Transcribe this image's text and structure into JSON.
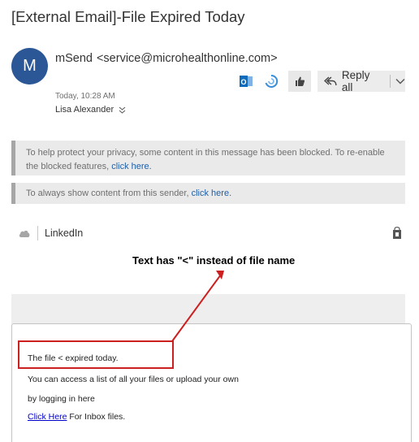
{
  "email": {
    "subject": "[External Email]-File Expired Today",
    "avatar_initial": "M",
    "sender_name": "mSend",
    "sender_address": "<service@microhealthonline.com>",
    "time": "Today, 10:28 AM",
    "recipient": "Lisa Alexander"
  },
  "toolbar": {
    "reply_all_label": "Reply all"
  },
  "notices": {
    "blocked_text": "To help protect your privacy, some content in this message has been blocked. To re-enable the blocked features, ",
    "blocked_link": "click here.",
    "sender_text": "To always show content from this sender, ",
    "sender_link": "click here."
  },
  "addin": {
    "name": "LinkedIn"
  },
  "body": {
    "line1": "The file < expired today.",
    "line2": "You can access a list of all your files or upload your own",
    "line3": "by logging in here",
    "link": "Click Here",
    "line4_rest": " For Inbox files."
  },
  "annotation": {
    "text": "Text has \"<\" instead of file name",
    "color": "#cc1f1f"
  },
  "colors": {
    "avatar": "#2b5797",
    "link": "#1f5fa6"
  }
}
